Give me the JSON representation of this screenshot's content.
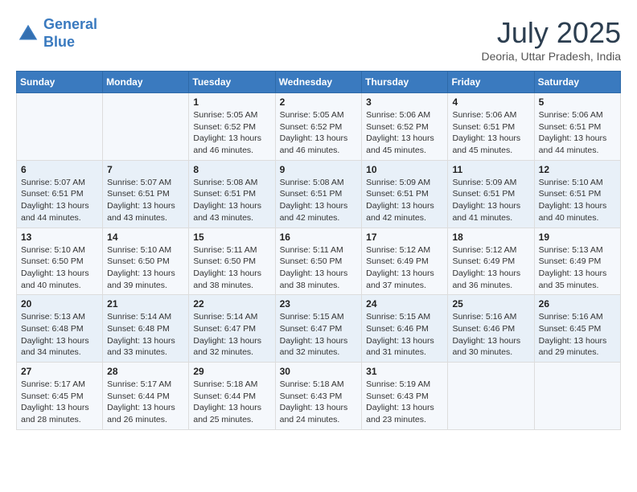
{
  "header": {
    "logo_line1": "General",
    "logo_line2": "Blue",
    "month_year": "July 2025",
    "location": "Deoria, Uttar Pradesh, India"
  },
  "weekdays": [
    "Sunday",
    "Monday",
    "Tuesday",
    "Wednesday",
    "Thursday",
    "Friday",
    "Saturday"
  ],
  "weeks": [
    [
      {
        "day": "",
        "info": ""
      },
      {
        "day": "",
        "info": ""
      },
      {
        "day": "1",
        "info": "Sunrise: 5:05 AM\nSunset: 6:52 PM\nDaylight: 13 hours and 46 minutes."
      },
      {
        "day": "2",
        "info": "Sunrise: 5:05 AM\nSunset: 6:52 PM\nDaylight: 13 hours and 46 minutes."
      },
      {
        "day": "3",
        "info": "Sunrise: 5:06 AM\nSunset: 6:52 PM\nDaylight: 13 hours and 45 minutes."
      },
      {
        "day": "4",
        "info": "Sunrise: 5:06 AM\nSunset: 6:51 PM\nDaylight: 13 hours and 45 minutes."
      },
      {
        "day": "5",
        "info": "Sunrise: 5:06 AM\nSunset: 6:51 PM\nDaylight: 13 hours and 44 minutes."
      }
    ],
    [
      {
        "day": "6",
        "info": "Sunrise: 5:07 AM\nSunset: 6:51 PM\nDaylight: 13 hours and 44 minutes."
      },
      {
        "day": "7",
        "info": "Sunrise: 5:07 AM\nSunset: 6:51 PM\nDaylight: 13 hours and 43 minutes."
      },
      {
        "day": "8",
        "info": "Sunrise: 5:08 AM\nSunset: 6:51 PM\nDaylight: 13 hours and 43 minutes."
      },
      {
        "day": "9",
        "info": "Sunrise: 5:08 AM\nSunset: 6:51 PM\nDaylight: 13 hours and 42 minutes."
      },
      {
        "day": "10",
        "info": "Sunrise: 5:09 AM\nSunset: 6:51 PM\nDaylight: 13 hours and 42 minutes."
      },
      {
        "day": "11",
        "info": "Sunrise: 5:09 AM\nSunset: 6:51 PM\nDaylight: 13 hours and 41 minutes."
      },
      {
        "day": "12",
        "info": "Sunrise: 5:10 AM\nSunset: 6:51 PM\nDaylight: 13 hours and 40 minutes."
      }
    ],
    [
      {
        "day": "13",
        "info": "Sunrise: 5:10 AM\nSunset: 6:50 PM\nDaylight: 13 hours and 40 minutes."
      },
      {
        "day": "14",
        "info": "Sunrise: 5:10 AM\nSunset: 6:50 PM\nDaylight: 13 hours and 39 minutes."
      },
      {
        "day": "15",
        "info": "Sunrise: 5:11 AM\nSunset: 6:50 PM\nDaylight: 13 hours and 38 minutes."
      },
      {
        "day": "16",
        "info": "Sunrise: 5:11 AM\nSunset: 6:50 PM\nDaylight: 13 hours and 38 minutes."
      },
      {
        "day": "17",
        "info": "Sunrise: 5:12 AM\nSunset: 6:49 PM\nDaylight: 13 hours and 37 minutes."
      },
      {
        "day": "18",
        "info": "Sunrise: 5:12 AM\nSunset: 6:49 PM\nDaylight: 13 hours and 36 minutes."
      },
      {
        "day": "19",
        "info": "Sunrise: 5:13 AM\nSunset: 6:49 PM\nDaylight: 13 hours and 35 minutes."
      }
    ],
    [
      {
        "day": "20",
        "info": "Sunrise: 5:13 AM\nSunset: 6:48 PM\nDaylight: 13 hours and 34 minutes."
      },
      {
        "day": "21",
        "info": "Sunrise: 5:14 AM\nSunset: 6:48 PM\nDaylight: 13 hours and 33 minutes."
      },
      {
        "day": "22",
        "info": "Sunrise: 5:14 AM\nSunset: 6:47 PM\nDaylight: 13 hours and 32 minutes."
      },
      {
        "day": "23",
        "info": "Sunrise: 5:15 AM\nSunset: 6:47 PM\nDaylight: 13 hours and 32 minutes."
      },
      {
        "day": "24",
        "info": "Sunrise: 5:15 AM\nSunset: 6:46 PM\nDaylight: 13 hours and 31 minutes."
      },
      {
        "day": "25",
        "info": "Sunrise: 5:16 AM\nSunset: 6:46 PM\nDaylight: 13 hours and 30 minutes."
      },
      {
        "day": "26",
        "info": "Sunrise: 5:16 AM\nSunset: 6:45 PM\nDaylight: 13 hours and 29 minutes."
      }
    ],
    [
      {
        "day": "27",
        "info": "Sunrise: 5:17 AM\nSunset: 6:45 PM\nDaylight: 13 hours and 28 minutes."
      },
      {
        "day": "28",
        "info": "Sunrise: 5:17 AM\nSunset: 6:44 PM\nDaylight: 13 hours and 26 minutes."
      },
      {
        "day": "29",
        "info": "Sunrise: 5:18 AM\nSunset: 6:44 PM\nDaylight: 13 hours and 25 minutes."
      },
      {
        "day": "30",
        "info": "Sunrise: 5:18 AM\nSunset: 6:43 PM\nDaylight: 13 hours and 24 minutes."
      },
      {
        "day": "31",
        "info": "Sunrise: 5:19 AM\nSunset: 6:43 PM\nDaylight: 13 hours and 23 minutes."
      },
      {
        "day": "",
        "info": ""
      },
      {
        "day": "",
        "info": ""
      }
    ]
  ]
}
